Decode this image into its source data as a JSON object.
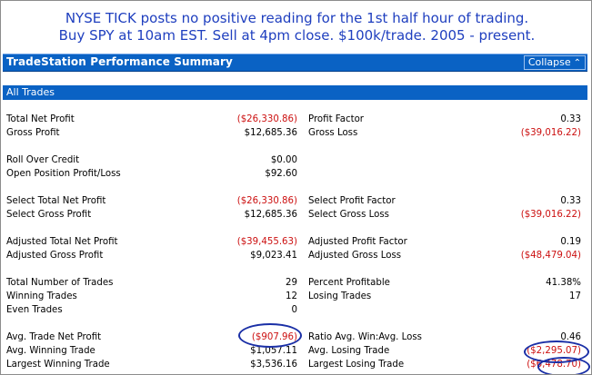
{
  "headline": {
    "line1": "NYSE TICK posts no positive reading for the 1st half hour of trading.",
    "line2": "Buy SPY at 10am EST. Sell at 4pm close. $100k/trade. 2005 - present."
  },
  "panel": {
    "title": "TradeStation Performance Summary",
    "collapse_label": "Collapse",
    "collapse_icon": "double-chevron-up-icon",
    "section_label": "All Trades"
  },
  "colors": {
    "accent": "#0a62c4",
    "negative": "#cc1010",
    "headline": "#1f3fbf",
    "highlight": "#1a2fa6"
  },
  "rows": [
    {
      "l1": "Total Net Profit",
      "v1": "($26,330.86)",
      "n1": true,
      "l2": "Profit Factor",
      "v2": "0.33",
      "n2": false
    },
    {
      "l1": "Gross Profit",
      "v1": "$12,685.36",
      "n1": false,
      "l2": "Gross Loss",
      "v2": "($39,016.22)",
      "n2": true
    },
    {
      "l1": "Roll Over Credit",
      "v1": "$0.00",
      "n1": false,
      "l2": "",
      "v2": "",
      "n2": false
    },
    {
      "l1": "Open Position Profit/Loss",
      "v1": "$92.60",
      "n1": false,
      "l2": "",
      "v2": "",
      "n2": false
    },
    {
      "l1": "Select Total Net Profit",
      "v1": "($26,330.86)",
      "n1": true,
      "l2": "Select Profit Factor",
      "v2": "0.33",
      "n2": false
    },
    {
      "l1": "Select Gross Profit",
      "v1": "$12,685.36",
      "n1": false,
      "l2": "Select Gross Loss",
      "v2": "($39,016.22)",
      "n2": true
    },
    {
      "l1": "Adjusted Total Net Profit",
      "v1": "($39,455.63)",
      "n1": true,
      "l2": "Adjusted Profit Factor",
      "v2": "0.19",
      "n2": false
    },
    {
      "l1": "Adjusted Gross Profit",
      "v1": "$9,023.41",
      "n1": false,
      "l2": "Adjusted Gross Loss",
      "v2": "($48,479.04)",
      "n2": true
    },
    {
      "l1": "Total Number of Trades",
      "v1": "29",
      "n1": false,
      "l2": "Percent Profitable",
      "v2": "41.38%",
      "n2": false
    },
    {
      "l1": "Winning Trades",
      "v1": "12",
      "n1": false,
      "l2": "Losing Trades",
      "v2": "17",
      "n2": false
    },
    {
      "l1": "Even Trades",
      "v1": "0",
      "n1": false,
      "l2": "",
      "v2": "",
      "n2": false
    },
    {
      "l1": "Avg. Trade Net Profit",
      "v1": "($907.96)",
      "n1": true,
      "l2": "Ratio Avg. Win:Avg. Loss",
      "v2": "0.46",
      "n2": false
    },
    {
      "l1": "Avg. Winning Trade",
      "v1": "$1,057.11",
      "n1": false,
      "l2": "Avg. Losing Trade",
      "v2": "($2,295.07)",
      "n2": true
    },
    {
      "l1": "Largest Winning Trade",
      "v1": "$3,536.16",
      "n1": false,
      "l2": "Largest Losing Trade",
      "v2": "($6,478.70)",
      "n2": true
    }
  ]
}
